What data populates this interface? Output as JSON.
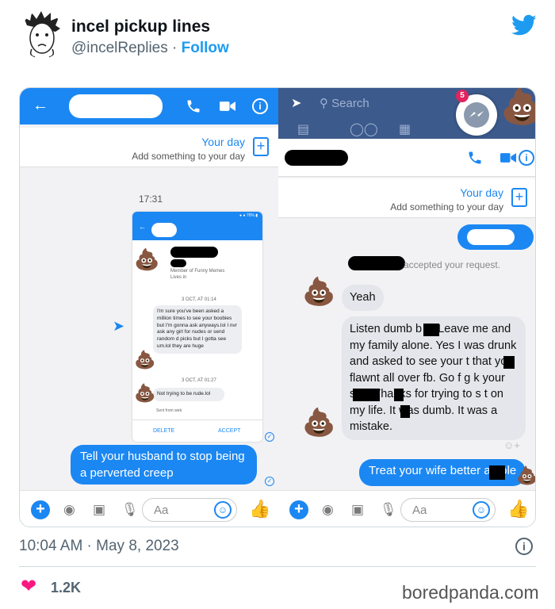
{
  "tweet": {
    "display_name": "incel pickup lines",
    "handle": "@incelReplies",
    "separator": "·",
    "follow_label": "Follow",
    "timestamp": "10:04 AM · May 8, 2023",
    "like_count": "1.2K",
    "accent_color": "#1d9bf0",
    "heart_color": "#f91880"
  },
  "left_panel": {
    "your_day_title": "Your day",
    "your_day_sub": "Add something to your day",
    "time_label": "17:31",
    "phone": {
      "member_line": "Member of Funny Memes",
      "lives_line": "Lives in",
      "date1": "3 OCT, AT 01:14",
      "message": "I'm sure you've been asked a million times to see your boobies but I'm gonna ask anyways.lol I nvr ask any girl for nudes or send random d  picks but I gotta see um.lol they are huge",
      "date2": "3 OCT, AT 01:27",
      "message2": "Not trying to be rude.lol",
      "sent_from": "Sent from web",
      "delete_label": "DELETE",
      "accept_label": "ACCEPT"
    },
    "sent_message": "Tell your husband to stop being a perverted creep",
    "composer_placeholder": "Aa"
  },
  "right_panel": {
    "search_placeholder": "Search",
    "badge_count": "5",
    "your_day_title": "Your day",
    "your_day_sub": "Add something to your day",
    "accepted_text": "accepted your request.",
    "reply1": "Yeah",
    "reply2": "Listen dumb b   h. Leave me and my family alone. Yes I was drunk and asked to see your t   that you flawnt all over fb. Go f      g k   your self. Thanks for trying to s   t on my life. It was dumb. It was a mistake.",
    "sent_message": "Treat your wife better a    hole",
    "composer_placeholder": "Aa"
  },
  "footer": {
    "watermark": "boredpanda.com"
  }
}
